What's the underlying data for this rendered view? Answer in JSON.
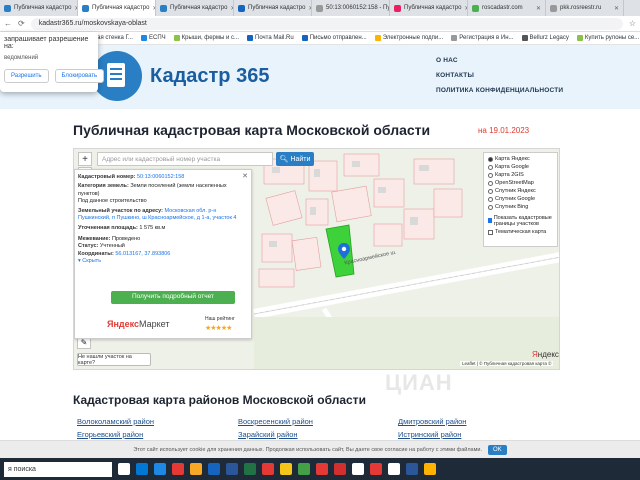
{
  "browser": {
    "tabs": [
      {
        "title": "Публичная кадастро",
        "color": "#2a7fc4",
        "active": false
      },
      {
        "title": "Публичная кадастро",
        "color": "#2a7fc4",
        "active": true
      },
      {
        "title": "Публичная кадастро",
        "color": "#2a7fc4",
        "active": false
      },
      {
        "title": "Публичная кадастро",
        "color": "#1565c0",
        "active": false
      },
      {
        "title": "50:13:0060152:158 - Пу",
        "color": "#999999",
        "active": false
      },
      {
        "title": "Публичная кадастро",
        "color": "#e91e63",
        "active": false
      },
      {
        "title": "roscadastr.com",
        "color": "#4caf50",
        "active": false
      },
      {
        "title": "pkk.rosreestr.ru",
        "color": "#999999",
        "active": false
      }
    ],
    "address": "kadastr365.ru/moskovskaya-oblast",
    "bookmarks": [
      {
        "label": "http://kadastr.ru/...",
        "color": "#999999"
      },
      {
        "label": "Шведская стенка Г...",
        "color": "#e53935"
      },
      {
        "label": "ЕСПЧ",
        "color": "#1e88e5"
      },
      {
        "label": "Крыши, фермы и с...",
        "color": "#8bc34a"
      },
      {
        "label": "Почта Mail.Ru",
        "color": "#1565c0"
      },
      {
        "label": "Письмо отправлен...",
        "color": "#1565c0"
      },
      {
        "label": "Электронные подпи...",
        "color": "#ffb300"
      },
      {
        "label": "Регистрация в Ин...",
        "color": "#999999"
      },
      {
        "label": "Bellurz Legacy",
        "color": "#555555"
      },
      {
        "label": "Купить рулоны се...",
        "color": "#8bc34a"
      }
    ]
  },
  "permission_popup": {
    "title": "запрашивает разрешение на:",
    "text": "ведомлений",
    "allow": "Разрешить",
    "block": "Блокировать"
  },
  "header": {
    "logo_text": "Кадастр 365",
    "nav": [
      "О НАС",
      "КОНТАКТЫ",
      "ПОЛИТИКА КОНФИДЕНЦИАЛЬНОСТИ"
    ]
  },
  "main": {
    "title": "Публичная кадастровая карта Московской области",
    "date": "на 19.01.2023"
  },
  "map": {
    "search_placeholder": "Адрес или кадастровый номер участка",
    "search_button": "Найти",
    "info": {
      "cad_label": "Кадастровый номер:",
      "cad_value": "50:13:0060152:158",
      "cat_label": "Категория земель:",
      "cat_value": "Земли поселений (земли населенных пунктов)",
      "use_value": "Под данное строительство",
      "addr_label": "Земельный участок по адресу:",
      "addr_value": "Московская обл. р-н Пушкинский, п Пушкино, ш Красноармейское, д 1-а, участок 4",
      "area_label": "Уточненная площадь:",
      "area_value": "1 575 кв.м",
      "inspect_label": "Межевание:",
      "inspect_value": "Проведено",
      "status_label": "Статус:",
      "status_value": "Учтенный",
      "coords_label": "Координаты:",
      "coords_value": "56.013167, 37.893806",
      "toggle": "Скрыть",
      "detail_button": "Получить подробный отчет",
      "market_a": "Яндекс",
      "market_b": "Маркет",
      "rating_label": "Наш рейтинг",
      "stars": "★★★★★"
    },
    "layers": {
      "options": [
        "Карта Яндекс",
        "Карта Google",
        "Карта 2GIS",
        "OpenStreetMap",
        "Спутник Яндекс",
        "Спутник Google",
        "Спутник Bing"
      ],
      "selected": 0,
      "checkbox1": "Показать кадастровые границы участков",
      "checkbox2": "Тематическая карта"
    },
    "street": "Красноармейское ш.",
    "not_found": "Не нашли участок на карте?",
    "copyright": "Leaflet | © Публичная кадастровая карта ©",
    "yandex_a": "Я",
    "yandex_b": "ндекс"
  },
  "section": {
    "title": "Кадастровая карта районов Московской области",
    "districts": [
      [
        "Волоколамский район",
        "Воскресенский район",
        "Дмитровский район"
      ],
      [
        "Егорьевский район",
        "Зарайский район",
        "Истринский район"
      ]
    ]
  },
  "cookie": {
    "text": "Этот сайт использует cookie для хранения данных. Продолжая использовать сайт, Вы даете свое согласие на работу с этими файлами.",
    "ok": "OK"
  },
  "taskbar": {
    "search": "я поиска",
    "icon_colors": [
      "#ffffff",
      "#0078d4",
      "#1e88e5",
      "#e53935",
      "#f9a825",
      "#1565c0",
      "#2b579a",
      "#217346",
      "#e53935",
      "#f5c518",
      "#43a047",
      "#e53935",
      "#d32f2f",
      "#ffffff",
      "#e53935",
      "#ffffff",
      "#2b579a",
      "#ffb300"
    ]
  },
  "watermark": "ЦИАН"
}
